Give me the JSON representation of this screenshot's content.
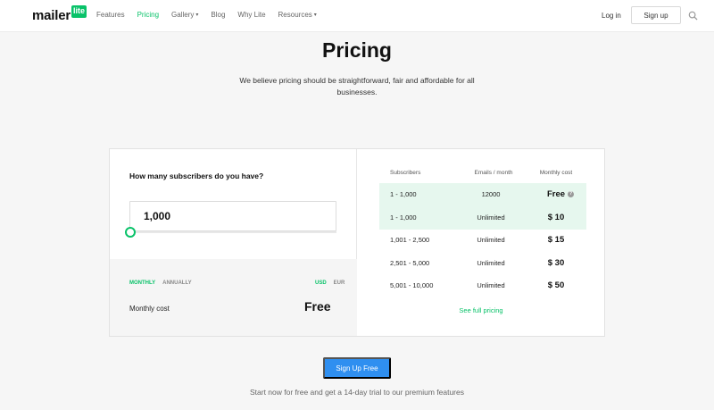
{
  "header": {
    "logo_text": "mailer",
    "logo_badge": "lite",
    "nav": [
      "Features",
      "Pricing",
      "Gallery",
      "Blog",
      "Why Lite",
      "Resources"
    ],
    "login": "Log in",
    "signup": "Sign up"
  },
  "hero": {
    "title": "Pricing",
    "subtitle": "We believe pricing should be straightforward, fair and affordable for all businesses."
  },
  "calculator": {
    "question": "How many subscribers do you have?",
    "subscribers_value": "1,000",
    "slider_fraction": 0.0,
    "billing": {
      "monthly": "MONTHLY",
      "annually": "ANNUALLY",
      "selected": "MONTHLY"
    },
    "currency": {
      "usd": "USD",
      "eur": "EUR",
      "selected": "USD"
    },
    "monthly_cost_label": "Monthly cost",
    "monthly_cost_value": "Free"
  },
  "table": {
    "headers": [
      "Subscribers",
      "Emails / month",
      "Monthly cost"
    ],
    "rows": [
      {
        "subscribers": "1 - 1,000",
        "emails": "12000",
        "cost": "Free",
        "highlight": true
      },
      {
        "subscribers": "1 - 1,000",
        "emails": "Unlimited",
        "cost": "$ 10",
        "highlight": true
      },
      {
        "subscribers": "1,001 - 2,500",
        "emails": "Unlimited",
        "cost": "$ 15",
        "highlight": false
      },
      {
        "subscribers": "2,501 - 5,000",
        "emails": "Unlimited",
        "cost": "$ 30",
        "highlight": false
      },
      {
        "subscribers": "5,001 - 10,000",
        "emails": "Unlimited",
        "cost": "$ 50",
        "highlight": false
      }
    ],
    "help_glyph": "?",
    "full_pricing_link": "See full pricing"
  },
  "cta": {
    "button": "Sign Up Free",
    "note": "Start now for free and get a 14-day trial to our premium features"
  },
  "colors": {
    "brand_green": "#09c269",
    "cta_blue": "#2f8ff0",
    "highlight_row": "#e6f7ee"
  }
}
